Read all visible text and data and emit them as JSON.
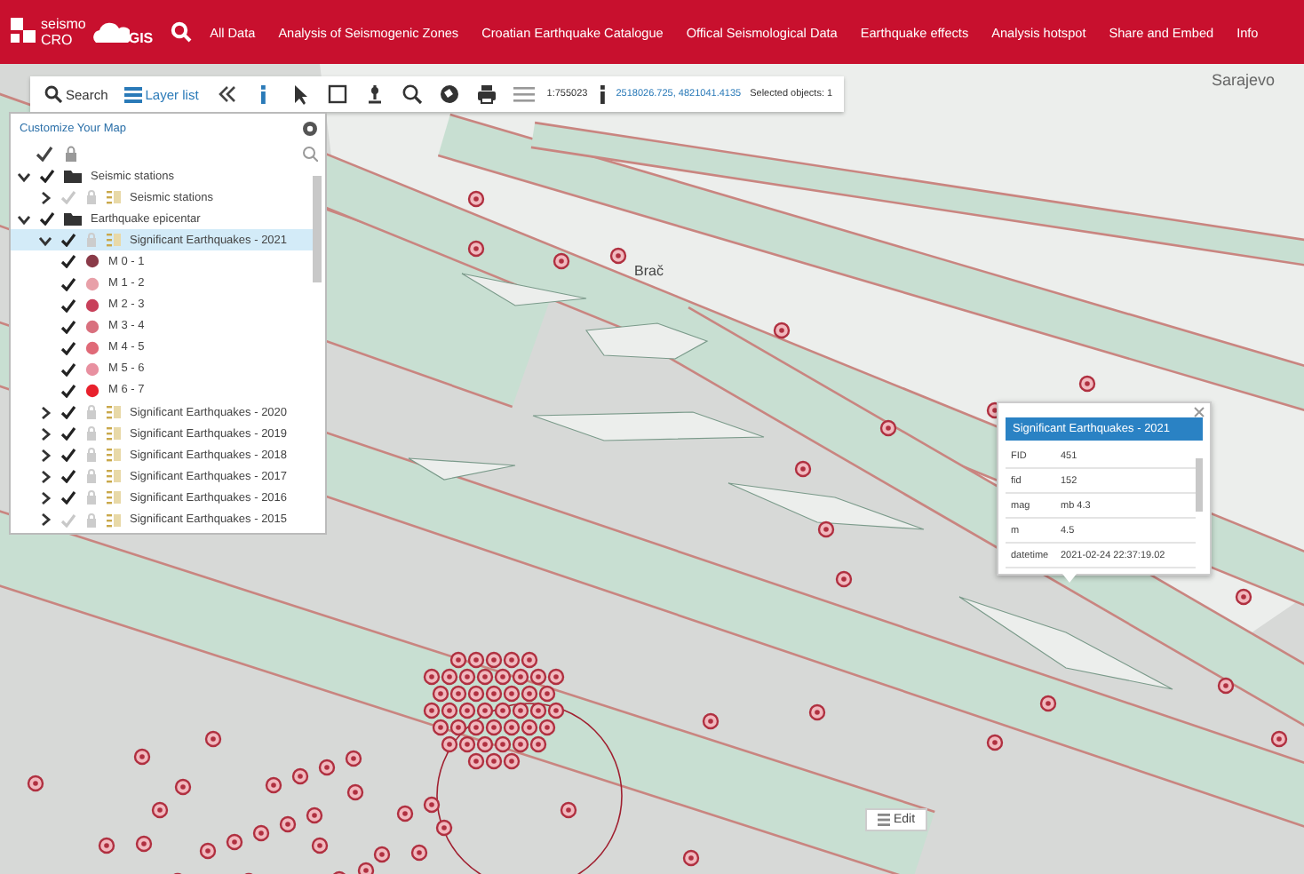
{
  "header": {
    "logo_top": "seismo",
    "logo_bottom": "CRO",
    "logo_gis": "GIS",
    "menu": [
      {
        "label": "All Data"
      },
      {
        "label": "Analysis of Seismogenic Zones"
      },
      {
        "label": "Croatian Earthquake Catalogue"
      },
      {
        "label": "Offical Seismological Data"
      },
      {
        "label": "Earthquake effects"
      },
      {
        "label": "Analysis hotspot"
      },
      {
        "label": "Share and Embed"
      },
      {
        "label": "Info"
      }
    ]
  },
  "toolbar": {
    "search": "Search",
    "layer_list": "Layer list",
    "scale": "1:755023",
    "coordinates": "2518026.725, 4821041.4135",
    "selected": "Selected objects: 1"
  },
  "layer_panel": {
    "title": "Customize Your Map",
    "tree": [
      {
        "label": "Seismic stations",
        "kind": "folder",
        "checked": true,
        "expanded": true,
        "selected": false,
        "children": [
          {
            "label": "Seismic stations",
            "kind": "layer",
            "checked": false,
            "expanded": false,
            "selected": false
          }
        ]
      },
      {
        "label": "Earthquake epicentar",
        "kind": "folder",
        "checked": true,
        "expanded": true,
        "selected": false,
        "children": [
          {
            "label": "Significant Earthquakes - 2021",
            "kind": "layer",
            "checked": true,
            "expanded": true,
            "selected": true,
            "children": [
              {
                "label": "M 0 - 1",
                "kind": "class",
                "checked": true,
                "color": "#8a3a48"
              },
              {
                "label": "M 1 - 2",
                "kind": "class",
                "checked": true,
                "color": "#e8a0a8"
              },
              {
                "label": "M 2 - 3",
                "kind": "class",
                "checked": true,
                "color": "#c8405a"
              },
              {
                "label": "M 3 - 4",
                "kind": "class",
                "checked": true,
                "color": "#d9707e"
              },
              {
                "label": "M 4 - 5",
                "kind": "class",
                "checked": true,
                "color": "#e06a78"
              },
              {
                "label": "M 5 - 6",
                "kind": "class",
                "checked": true,
                "color": "#e890a0"
              },
              {
                "label": "M 6 - 7",
                "kind": "class",
                "checked": true,
                "color": "#e8202c"
              }
            ]
          },
          {
            "label": "Significant Earthquakes - 2020",
            "kind": "layer",
            "checked": true,
            "expanded": false,
            "selected": false
          },
          {
            "label": "Significant Earthquakes - 2019",
            "kind": "layer",
            "checked": true,
            "expanded": false,
            "selected": false
          },
          {
            "label": "Significant Earthquakes - 2018",
            "kind": "layer",
            "checked": true,
            "expanded": false,
            "selected": false
          },
          {
            "label": "Significant Earthquakes - 2017",
            "kind": "layer",
            "checked": true,
            "expanded": false,
            "selected": false
          },
          {
            "label": "Significant Earthquakes - 2016",
            "kind": "layer",
            "checked": true,
            "expanded": false,
            "selected": false
          },
          {
            "label": "Significant Earthquakes - 2015",
            "kind": "layer",
            "checked": false,
            "expanded": false,
            "selected": false
          }
        ]
      }
    ]
  },
  "map": {
    "places": [
      {
        "label": "Sarajevo"
      },
      {
        "label": "Brač"
      }
    ]
  },
  "popup": {
    "title": "Significant Earthquakes - 2021",
    "rows": [
      {
        "key": "FID",
        "value": "451"
      },
      {
        "key": "fid",
        "value": "152"
      },
      {
        "key": "mag",
        "value": "mb 4.3"
      },
      {
        "key": "m",
        "value": "4.5"
      },
      {
        "key": "datetime",
        "value": "2021-02-24 22:37:19.02"
      }
    ]
  },
  "edit_button": "Edit"
}
